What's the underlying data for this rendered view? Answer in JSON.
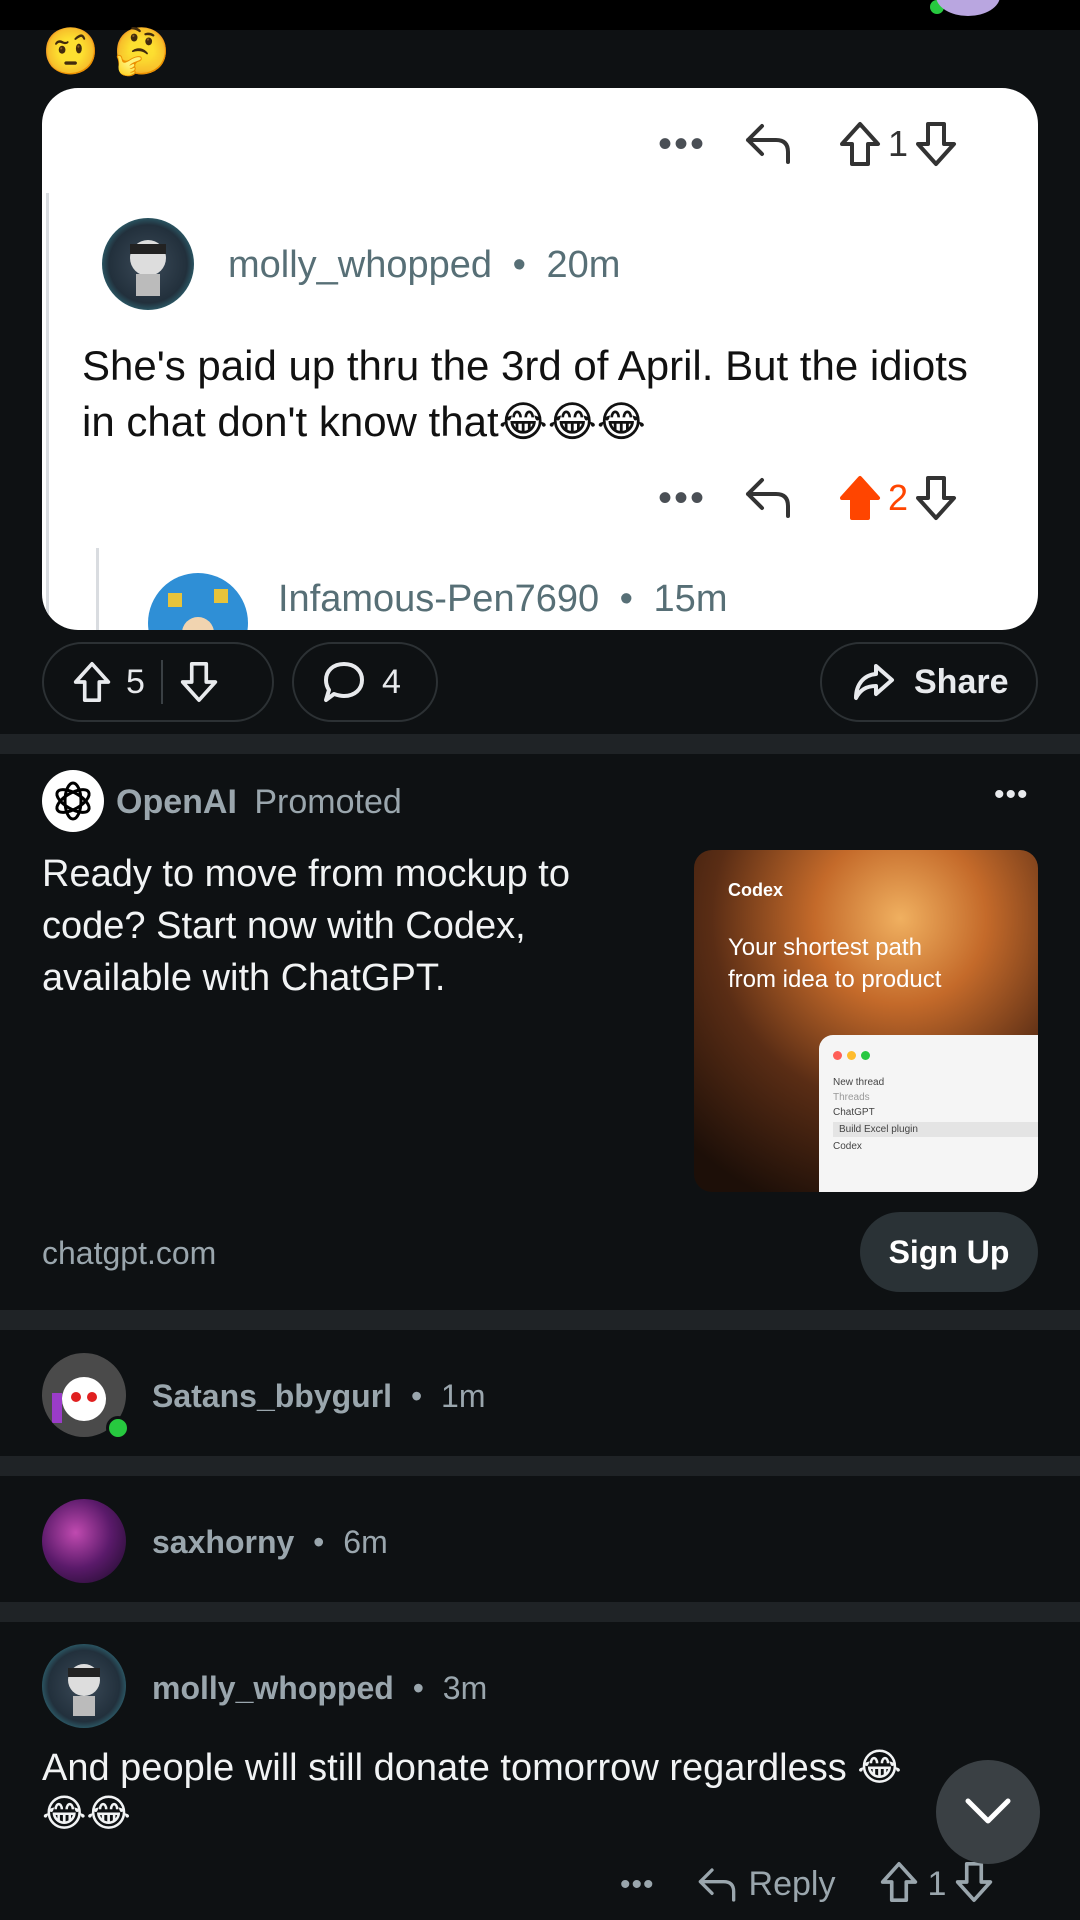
{
  "colors": {
    "accent_orange": "#ff4500",
    "background": "#0e1113",
    "card_bg": "#ffffff",
    "online_green": "#27c93f"
  },
  "top_emojis": [
    "🤨",
    "🤔"
  ],
  "embedded_card": {
    "top_actions": {
      "more": "•••",
      "upvote_count": "1"
    },
    "comment1": {
      "username": "molly_whopped",
      "time": "20m",
      "text": "She's paid up thru the 3rd of April. But the idiots in chat don't know that",
      "emojis": "😂😂😂",
      "upvote_count": "2"
    },
    "comment2": {
      "username": "Infamous-Pen7690",
      "time": "15m"
    }
  },
  "post_actions": {
    "upvotes": "5",
    "comments": "4",
    "share_label": "Share"
  },
  "ad": {
    "brand": "OpenAI",
    "promoted": "Promoted",
    "more": "•••",
    "text": "Ready to move from mockup to code? Start now with Codex, available with ChatGPT.",
    "image_brand": "Codex",
    "image_tagline": "Your shortest path from idea to product",
    "image_menu": [
      "New thread",
      "Threads",
      "ChatGPT",
      "Build Excel plugin",
      "Codex"
    ],
    "domain": "chatgpt.com",
    "cta": "Sign Up"
  },
  "comments": [
    {
      "username": "Satans_bbygurl",
      "time": "1m"
    },
    {
      "username": "saxhorny",
      "time": "6m"
    },
    {
      "username": "molly_whopped",
      "time": "3m",
      "text": "And people will still donate tomorrow regardless 😂😂😂",
      "reply_label": "Reply",
      "upvote_count": "1",
      "more": "•••"
    }
  ],
  "dot_sep": "•"
}
